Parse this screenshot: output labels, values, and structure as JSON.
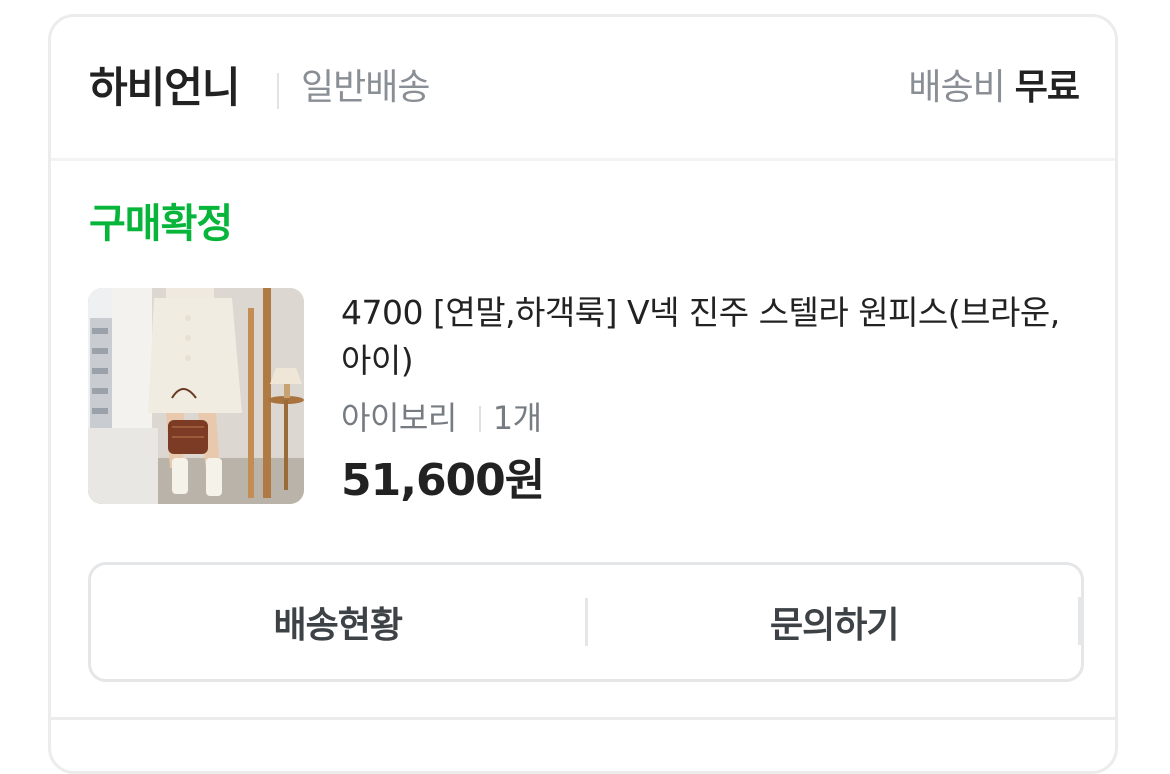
{
  "seller": {
    "name": "하비언니",
    "shipping_type": "일반배송",
    "shipping_fee_label": "배송비",
    "shipping_fee_value": "무료"
  },
  "order": {
    "status": "구매확정",
    "product_name": "4700 [연말,하객룩] V넥 진주 스텔라 원피스(브라운,아이)",
    "option": "아이보리",
    "quantity": "1개",
    "price": "51,600원"
  },
  "actions": {
    "tracking_label": "배송현황",
    "inquiry_label": "문의하기"
  },
  "colors": {
    "status_green": "#07b53b",
    "text_dark": "#222222",
    "text_gray": "#8a8f95"
  }
}
